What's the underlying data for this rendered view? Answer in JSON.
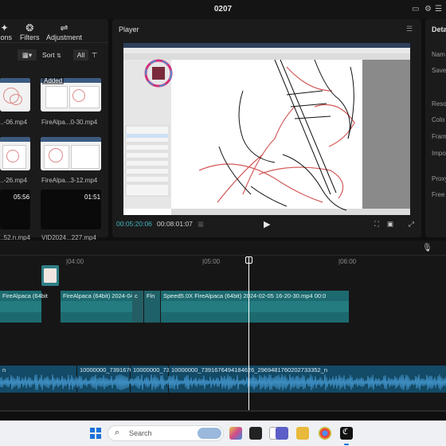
{
  "window": {
    "title": "0207"
  },
  "media": {
    "tools": [
      {
        "label": "tions",
        "icon": "effects-icon"
      },
      {
        "label": "Filters",
        "icon": "filters-icon"
      },
      {
        "label": "Adjustment",
        "icon": "adjustment-icon"
      }
    ],
    "sort_label": "Sort",
    "filter_label": "All",
    "items": [
      {
        "label": "...-06.mp4",
        "badge": "",
        "duration": ""
      },
      {
        "label": "FireAlpa...0-30.mp4",
        "badge": "Added",
        "duration": ""
      },
      {
        "label": "...-26.mp4",
        "badge": "",
        "duration": ""
      },
      {
        "label": "FireAlpa...3-12.mp4",
        "badge": "",
        "duration": ""
      },
      {
        "label": "...52.n.mp4",
        "badge": "",
        "duration": "05:56"
      },
      {
        "label": "VID2024...227.mp4",
        "badge": "",
        "duration": "01:51"
      }
    ]
  },
  "player": {
    "title": "Player",
    "current_time": "00:05:20:06",
    "total_time": "00:08:01:07"
  },
  "details": {
    "title": "Deta",
    "rows": [
      "Nam",
      "Save",
      "Reso",
      "Colo",
      "Fram",
      "Impo",
      "Proxy",
      "Free"
    ]
  },
  "timeline": {
    "ruler": [
      "|04:00",
      "|05:00",
      "|06:00"
    ],
    "video_clips": [
      {
        "label": "FireAlpaca (64bit"
      },
      {
        "label": "FireAlpaca (64bit) 2024-04"
      },
      {
        "label": "c"
      },
      {
        "label": "Fin"
      },
      {
        "label": "Speed5.0X  FireAlpaca (64bit) 2024-02-05 16-20-30.mp4   00:0"
      }
    ],
    "audio_clips": [
      {
        "label": "n"
      },
      {
        "label": "10000000_7391676"
      },
      {
        "label": "10000000_73"
      },
      {
        "label": "10000000_7391676494184626_2969481760202733352_n"
      }
    ]
  },
  "taskbar": {
    "search_placeholder": "Search"
  },
  "colors": {
    "accent_time": "#3fb6c0",
    "video_clip": "#1c6a6f",
    "audio_clip": "#134a66",
    "playhead": "#ffffff"
  }
}
